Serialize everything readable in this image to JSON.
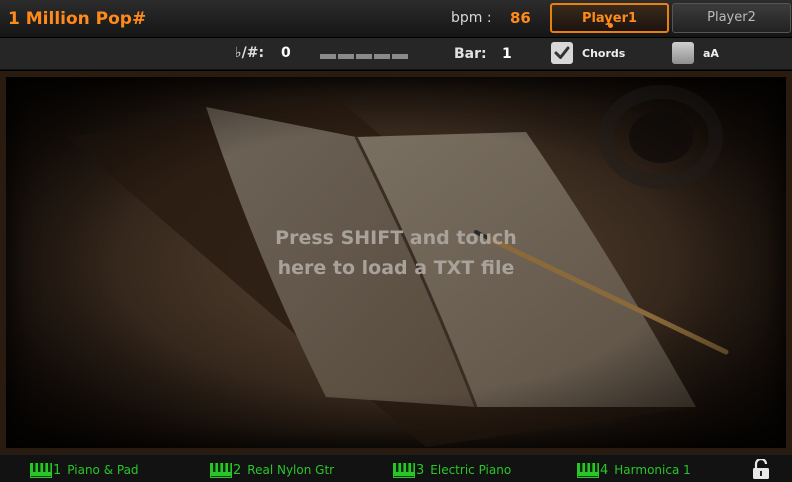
{
  "header": {
    "song_title": "1 Million Pop#",
    "bpm_label": "bpm :",
    "bpm_value": "86",
    "player1_label": "Player1",
    "player2_label": "Player2"
  },
  "controls": {
    "transpose_label": "b/#:",
    "transpose_value": "0",
    "bar_label": "Bar:",
    "bar_value": "1",
    "chords_label": "Chords",
    "chords_checked": true,
    "aa_label": "aA",
    "aa_checked": false
  },
  "main": {
    "hint_line1": "Press SHIFT and touch",
    "hint_line2": "here to load a TXT file"
  },
  "tracks": [
    {
      "number": "1",
      "name": "Piano & Pad"
    },
    {
      "number": "2",
      "name": "Real Nylon Gtr"
    },
    {
      "number": "3",
      "name": "Electric Piano"
    },
    {
      "number": "4",
      "name": "Harmonica 1"
    }
  ],
  "colors": {
    "accent": "#ff8a1a",
    "track_text": "#29c529"
  },
  "icons": {
    "track_icon": "keyboard-icon",
    "lock": "lock-open-icon"
  }
}
